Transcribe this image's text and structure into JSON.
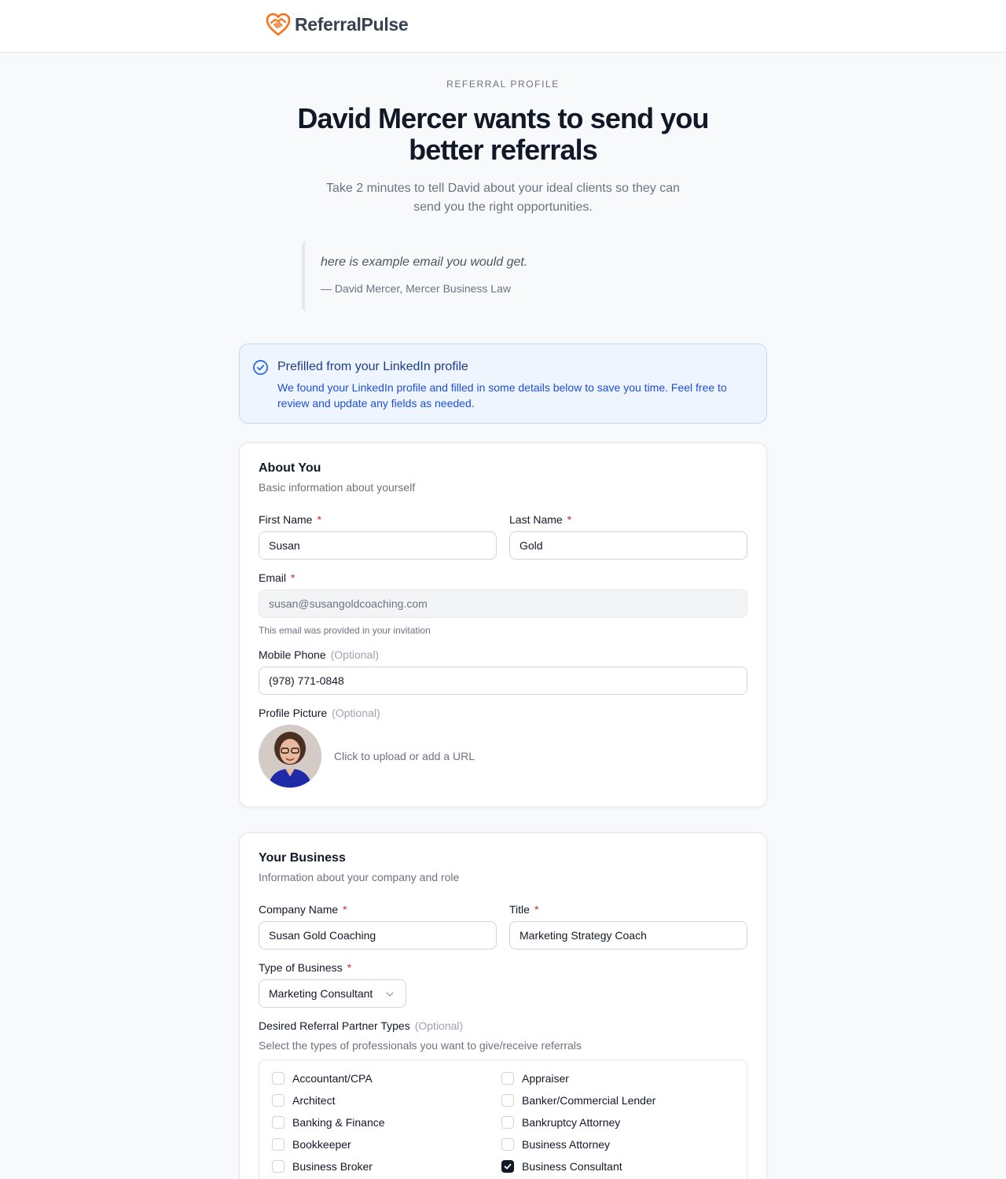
{
  "app": {
    "name": "ReferralPulse"
  },
  "hero": {
    "eyebrow": "REFERRAL PROFILE",
    "title": "David Mercer wants to send you better referrals",
    "subtitle": "Take 2 minutes to tell David about your ideal clients so they can send you the right opportunities."
  },
  "quote": {
    "text": "here is example email you would get.",
    "author": "— David Mercer, Mercer Business Law"
  },
  "notice": {
    "title": "Prefilled from your LinkedIn profile",
    "body": "We found your LinkedIn profile and filled in some details below to save you time. Feel free to review and update any fields as needed."
  },
  "about": {
    "title": "About You",
    "subtitle": "Basic information about yourself",
    "first_name": {
      "label": "First Name",
      "required": "*",
      "value": "Susan"
    },
    "last_name": {
      "label": "Last Name",
      "required": "*",
      "value": "Gold"
    },
    "email": {
      "label": "Email",
      "required": "*",
      "value": "susan@susangoldcoaching.com",
      "help": "This email was provided in your invitation"
    },
    "phone": {
      "label": "Mobile Phone",
      "optional": "(Optional)",
      "value": "(978) 771-0848"
    },
    "picture": {
      "label": "Profile Picture",
      "optional": "(Optional)",
      "upload_text": "Click to upload or add a URL"
    }
  },
  "business": {
    "title": "Your Business",
    "subtitle": "Information about your company and role",
    "company": {
      "label": "Company Name",
      "required": "*",
      "value": "Susan Gold Coaching"
    },
    "job_title": {
      "label": "Title",
      "required": "*",
      "value": "Marketing Strategy Coach"
    },
    "type": {
      "label": "Type of Business",
      "required": "*",
      "value": "Marketing Consultant"
    },
    "partners": {
      "label": "Desired Referral Partner Types",
      "optional": "(Optional)",
      "help": "Select the types of professionals you want to give/receive referrals",
      "items": [
        {
          "label": "Accountant/CPA",
          "checked": false
        },
        {
          "label": "Appraiser",
          "checked": false
        },
        {
          "label": "Architect",
          "checked": false
        },
        {
          "label": "Banker/Commercial Lender",
          "checked": false
        },
        {
          "label": "Banking & Finance",
          "checked": false
        },
        {
          "label": "Bankruptcy Attorney",
          "checked": false
        },
        {
          "label": "Bookkeeper",
          "checked": false
        },
        {
          "label": "Business Attorney",
          "checked": false
        },
        {
          "label": "Business Broker",
          "checked": false
        },
        {
          "label": "Business Consultant",
          "checked": true
        }
      ]
    }
  },
  "colors": {
    "brand": "#f97316",
    "accent": "#1d4ed8",
    "required": "#dc2626"
  }
}
